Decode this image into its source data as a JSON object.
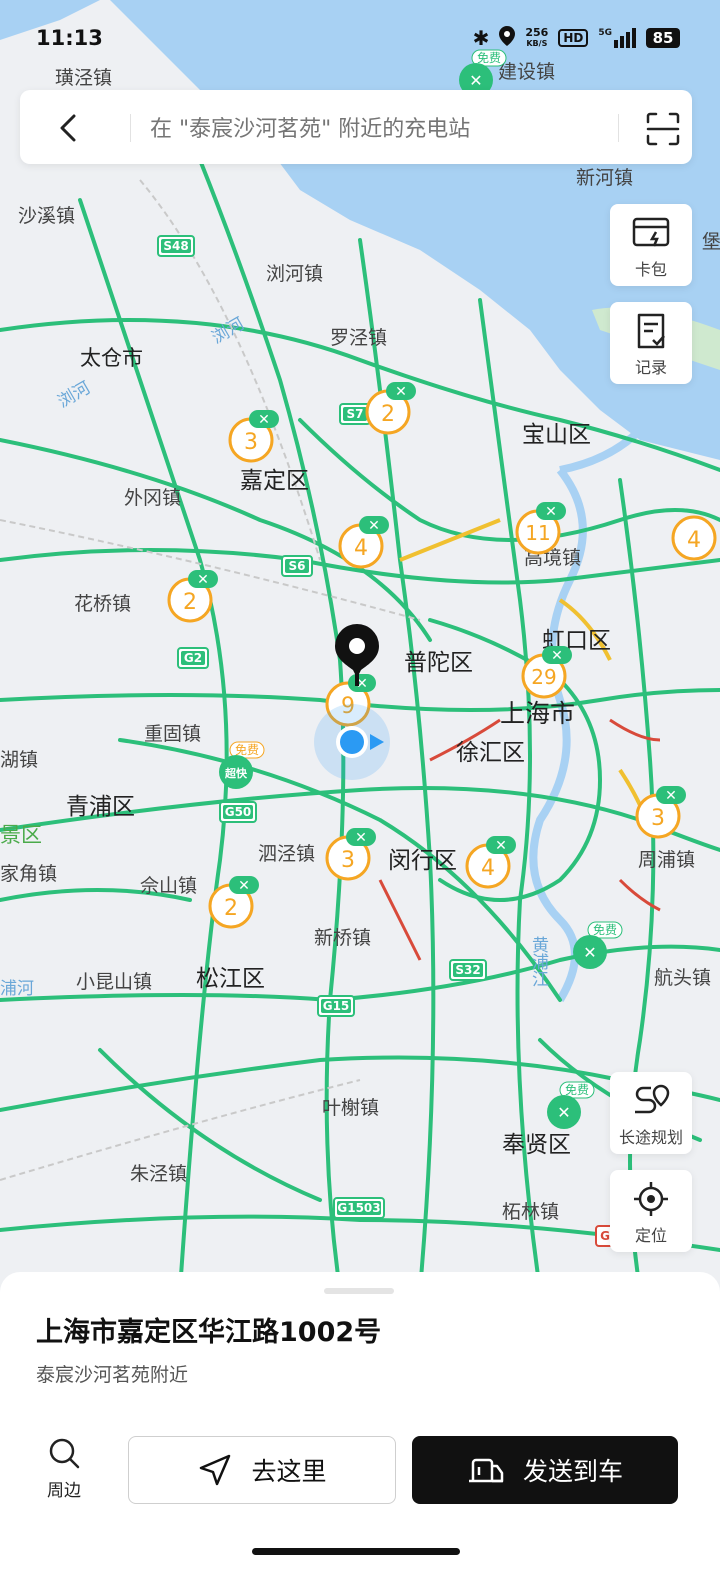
{
  "status_bar": {
    "time": "11:13",
    "speed_value": "256",
    "speed_unit": "KB/S",
    "hd": "HD",
    "network": "5G",
    "battery": "85"
  },
  "search": {
    "placeholder": "在 \"泰宸沙河茗苑\" 附近的充电站"
  },
  "side_buttons": {
    "wallet_label": "卡包",
    "records_label": "记录",
    "long_trip_label": "长途规划",
    "locate_label": "定位"
  },
  "map": {
    "places": [
      {
        "label": "璜泾镇"
      },
      {
        "label": "建设镇"
      },
      {
        "label": "新河镇"
      },
      {
        "label": "沙溪镇"
      },
      {
        "label": "浏河镇"
      },
      {
        "label": "罗泾镇"
      },
      {
        "label": "太仓市"
      },
      {
        "label": "浏河"
      },
      {
        "label": "浏河"
      },
      {
        "label": "宝山区"
      },
      {
        "label": "嘉定区"
      },
      {
        "label": "外冈镇"
      },
      {
        "label": "高境镇"
      },
      {
        "label": "花桥镇"
      },
      {
        "label": "虹口区"
      },
      {
        "label": "普陀区"
      },
      {
        "label": "上海市"
      },
      {
        "label": "重固镇"
      },
      {
        "label": "徐汇区"
      },
      {
        "label": "湖镇"
      },
      {
        "label": "青浦区"
      },
      {
        "label": "景区"
      },
      {
        "label": "泗泾镇"
      },
      {
        "label": "闵行区"
      },
      {
        "label": "周浦镇"
      },
      {
        "label": "家角镇"
      },
      {
        "label": "佘山镇"
      },
      {
        "label": "新桥镇"
      },
      {
        "label": "黄浦江"
      },
      {
        "label": "浦河"
      },
      {
        "label": "小昆山镇"
      },
      {
        "label": "松江区"
      },
      {
        "label": "航头镇"
      },
      {
        "label": "叶榭镇"
      },
      {
        "label": "奉贤区"
      },
      {
        "label": "朱泾镇"
      },
      {
        "label": "柘林镇"
      },
      {
        "label": "堡"
      }
    ],
    "road_badges": [
      "S48",
      "S7",
      "S6",
      "G2",
      "G50",
      "S32",
      "G15",
      "G1503",
      "G"
    ],
    "clusters": [
      "2",
      "3",
      "4",
      "11",
      "4",
      "2",
      "29",
      "9",
      "3",
      "3",
      "4",
      "2"
    ],
    "free_tag": "免费",
    "super_tag": "超快"
  },
  "sheet": {
    "address": "上海市嘉定区华江路1002号",
    "subtitle": "泰宸沙河茗苑附近",
    "nearby_label": "周边",
    "go_label": "去这里",
    "send_label": "发送到车"
  },
  "colors": {
    "road_green": "#2cbf7a",
    "cluster_orange": "#f5a623",
    "water_blue": "#9ccaf0",
    "location_blue": "#2b9af3"
  }
}
